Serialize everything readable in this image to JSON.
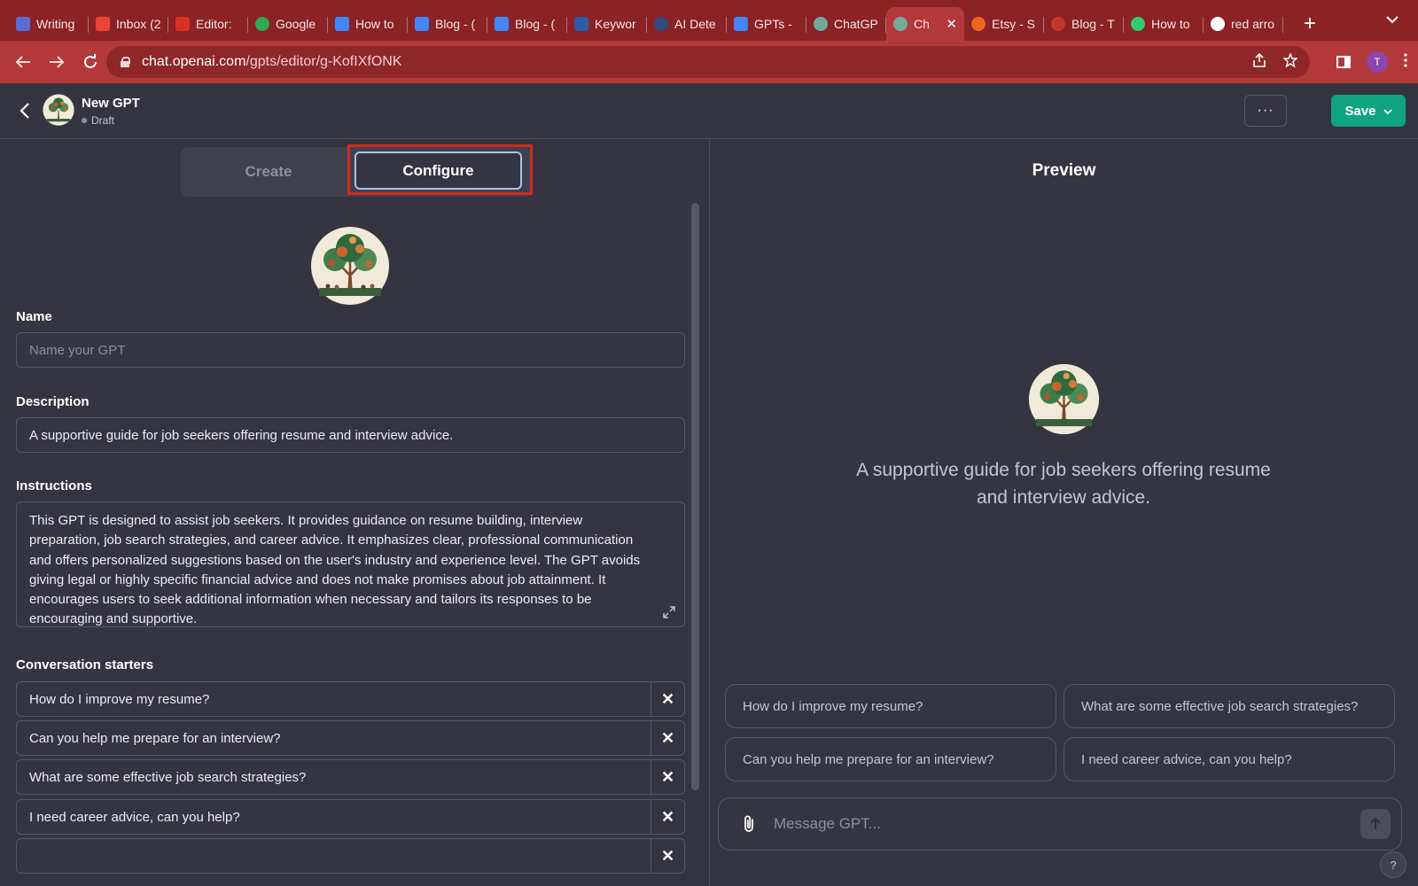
{
  "browser": {
    "tabs": [
      {
        "label": "Writing",
        "icon": "writing-favicon",
        "color": "#5b6bd6"
      },
      {
        "label": "Inbox (2",
        "icon": "gmail-favicon",
        "color": "#ea4335"
      },
      {
        "label": "Editor: ",
        "icon": "editor-favicon",
        "color": "#d93025"
      },
      {
        "label": "Google",
        "icon": "google-drive-favicon",
        "color": "#34a853"
      },
      {
        "label": "How to",
        "icon": "docs-favicon",
        "color": "#4285f4"
      },
      {
        "label": "Blog - (",
        "icon": "docs-favicon",
        "color": "#4285f4"
      },
      {
        "label": "Blog - (",
        "icon": "docs-favicon",
        "color": "#4285f4"
      },
      {
        "label": "Keywor",
        "icon": "keyword-chart-favicon",
        "color": "#2b5ba7"
      },
      {
        "label": "AI Dete",
        "icon": "ai-detector-favicon",
        "color": "#2f4b7c"
      },
      {
        "label": "GPTs -",
        "icon": "docs-favicon",
        "color": "#4285f4"
      },
      {
        "label": "ChatGP",
        "icon": "chatgpt-favicon",
        "color": "#74aa9c"
      },
      {
        "label": "Ch",
        "icon": "chatgpt-favicon",
        "color": "#74aa9c",
        "active": true
      },
      {
        "label": "Etsy - S",
        "icon": "etsy-favicon",
        "color": "#f1641e"
      },
      {
        "label": "Blog - T",
        "icon": "blog-favicon",
        "color": "#c0392b"
      },
      {
        "label": "How to",
        "icon": "burst-favicon",
        "color": "#2ecc71"
      },
      {
        "label": "red arro",
        "icon": "google-favicon",
        "color": "#ffffff"
      }
    ],
    "new_tab_label": "+",
    "url_host": "chat.openai.com",
    "url_path": "/gpts/editor/g-KofIXfONK",
    "profile_initial": "T"
  },
  "header": {
    "gpt_name": "New GPT",
    "status": "Draft",
    "more_label": "···",
    "save_label": "Save"
  },
  "tabs": {
    "create": "Create",
    "configure": "Configure"
  },
  "form": {
    "name_label": "Name",
    "name_placeholder": "Name your GPT",
    "description_label": "Description",
    "description_value": "A supportive guide for job seekers offering resume and interview advice.",
    "instructions_label": "Instructions",
    "instructions_value": "This GPT is designed to assist job seekers. It provides guidance on resume building, interview preparation, job search strategies, and career advice. It emphasizes clear, professional communication and offers personalized suggestions based on the user's industry and experience level. The GPT avoids giving legal or highly specific financial advice and does not make promises about job attainment. It encourages users to seek additional information when necessary and tailors its responses to be encouraging and supportive.",
    "starters_label": "Conversation starters",
    "starters": [
      "How do I improve my resume?",
      "Can you help me prepare for an interview?",
      "What are some effective job search strategies?",
      "I need career advice, can you help?",
      ""
    ]
  },
  "preview": {
    "title": "Preview",
    "description": "A supportive guide for job seekers offering resume and interview advice.",
    "chips": [
      "How do I improve my resume?",
      "What are some effective job search strategies?",
      "Can you help me prepare for an interview?",
      "I need career advice, can you help?"
    ],
    "message_placeholder": "Message GPT...",
    "help_label": "?"
  },
  "colors": {
    "background": "#343541",
    "tab_strip": "#8b2225",
    "toolbar": "#b3393b",
    "save_button": "#10a37f",
    "highlight_box": "#d22a1e",
    "border": "#565869"
  }
}
